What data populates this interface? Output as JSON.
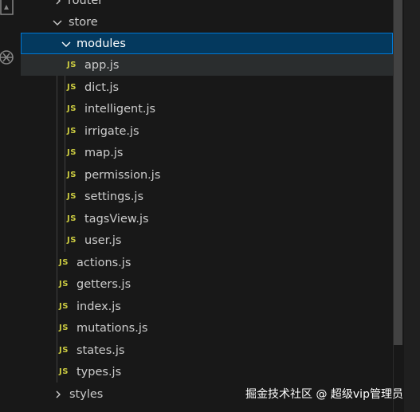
{
  "explorer": {
    "partial_top": {
      "label": "router"
    },
    "store": {
      "label": "store"
    },
    "modules": {
      "label": "modules",
      "files": [
        {
          "badge": "JS",
          "name": "app.js"
        },
        {
          "badge": "JS",
          "name": "dict.js"
        },
        {
          "badge": "JS",
          "name": "intelligent.js"
        },
        {
          "badge": "JS",
          "name": "irrigate.js"
        },
        {
          "badge": "JS",
          "name": "map.js"
        },
        {
          "badge": "JS",
          "name": "permission.js"
        },
        {
          "badge": "JS",
          "name": "settings.js"
        },
        {
          "badge": "JS",
          "name": "tagsView.js"
        },
        {
          "badge": "JS",
          "name": "user.js"
        }
      ]
    },
    "store_files": [
      {
        "badge": "JS",
        "name": "actions.js"
      },
      {
        "badge": "JS",
        "name": "getters.js"
      },
      {
        "badge": "JS",
        "name": "index.js"
      },
      {
        "badge": "JS",
        "name": "mutations.js"
      },
      {
        "badge": "JS",
        "name": "states.js"
      },
      {
        "badge": "JS",
        "name": "types.js"
      }
    ],
    "styles": {
      "label": "styles"
    }
  },
  "icons": {
    "activity_1": "document-icon",
    "activity_2": "openai-icon",
    "chevron_down": "chevron-down-icon",
    "chevron_right": "chevron-right-icon"
  },
  "colors": {
    "background": "#181818",
    "selection": "#04395e",
    "selection_border": "#0078d4",
    "js_badge": "#cbcb41",
    "text": "#cccccc"
  },
  "watermark": {
    "text": "掘金技术社区 @ 超级vip管理员"
  }
}
